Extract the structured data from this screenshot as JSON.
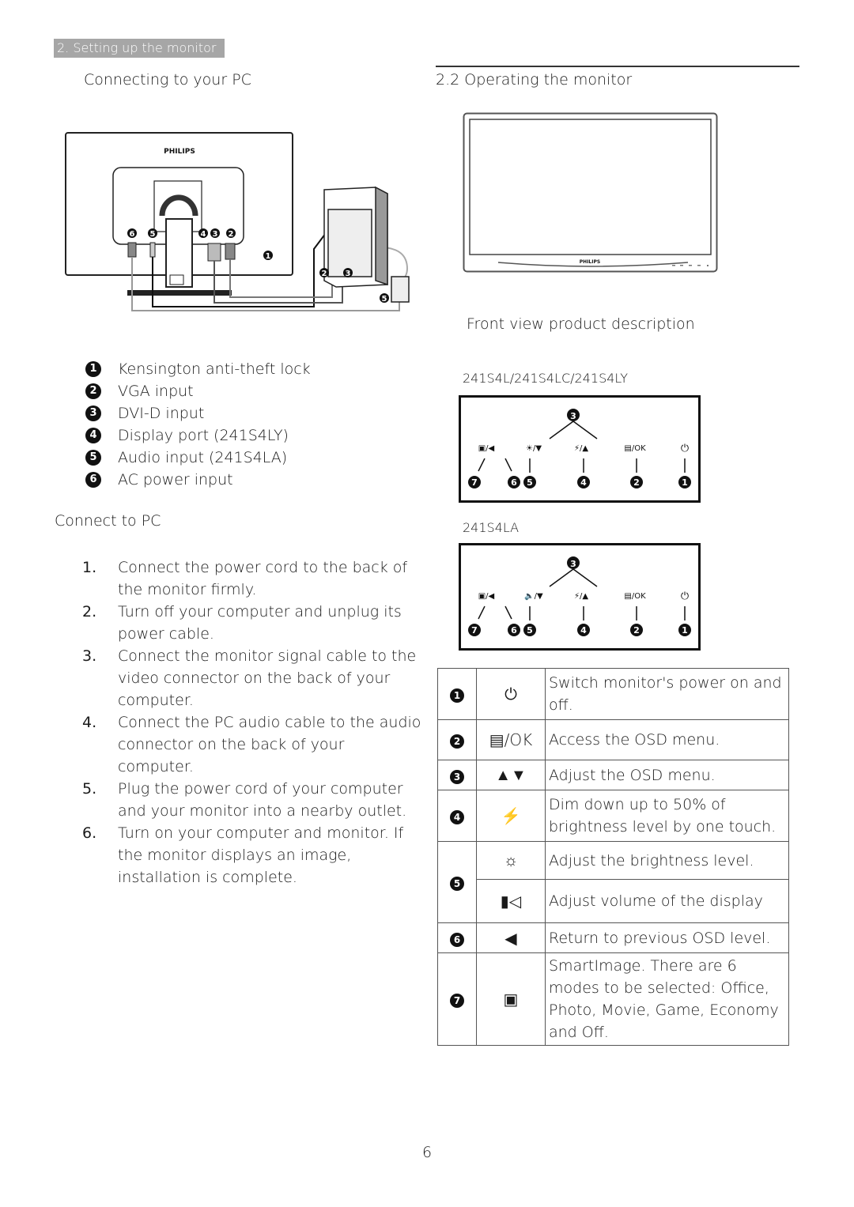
{
  "header": {
    "section_tab": "2. Setting up the monitor"
  },
  "left": {
    "title": "Connecting to your PC",
    "diagram": {
      "brand": "PHILIPS",
      "port_callouts": [
        "6",
        "5",
        "4",
        "3",
        "2",
        "1"
      ],
      "pc_callouts": [
        "2",
        "3",
        "5"
      ]
    },
    "legend": [
      {
        "num": "1",
        "label": "Kensington anti-theft lock"
      },
      {
        "num": "2",
        "label": "VGA input"
      },
      {
        "num": "3",
        "label": "DVI-D input"
      },
      {
        "num": "4",
        "label": "Display port (241S4LY)"
      },
      {
        "num": "5",
        "label": "Audio input (241S4LA)"
      },
      {
        "num": "6",
        "label": "AC power input"
      }
    ],
    "connect_title": "Connect to PC",
    "steps": [
      {
        "num": "1.",
        "text": "Connect the power cord to the back of the monitor firmly."
      },
      {
        "num": "2.",
        "text": "Turn off your computer and unplug its power cable."
      },
      {
        "num": "3.",
        "text": "Connect the monitor signal cable to the video connector on the back of your computer."
      },
      {
        "num": "4.",
        "text": "Connect the PC audio cable to the audio connector on the back of your computer."
      },
      {
        "num": "5.",
        "text": "Plug the power cord of your computer and your monitor into a nearby outlet."
      },
      {
        "num": "6.",
        "text": "Turn on your computer and monitor. If the monitor displays an image, installation is complete."
      }
    ]
  },
  "right": {
    "title": "2.2 Operating the monitor",
    "front_brand": "PHILIPS",
    "front_view_title": "Front view product description",
    "panels": [
      {
        "model": "241S4L/241S4LC/241S4LY",
        "buttons": [
          {
            "icon": "smartimage-back",
            "label": "▣/◀"
          },
          {
            "icon": "brightness-down",
            "label": "☀/▼"
          },
          {
            "icon": "smartcontrol-up",
            "label": "⚡/▲"
          },
          {
            "icon": "menu-ok",
            "label": "▤/OK"
          },
          {
            "icon": "power",
            "label": "⏻"
          }
        ],
        "callouts": [
          "7",
          "6",
          "5",
          "4",
          "2",
          "1"
        ],
        "top_callout": "3"
      },
      {
        "model": "241S4LA",
        "buttons": [
          {
            "icon": "smartimage-back",
            "label": "▣/◀"
          },
          {
            "icon": "volume-down",
            "label": "🔈/▼"
          },
          {
            "icon": "smartcontrol-up",
            "label": "⚡/▲"
          },
          {
            "icon": "menu-ok",
            "label": "▤/OK"
          },
          {
            "icon": "power",
            "label": "⏻"
          }
        ],
        "callouts": [
          "7",
          "6",
          "5",
          "4",
          "2",
          "1"
        ],
        "top_callout": "3"
      }
    ],
    "key_table": [
      {
        "num": "1",
        "icon": "power-icon",
        "symbol": "⏻",
        "desc": "Switch monitor's power on and off."
      },
      {
        "num": "2",
        "icon": "menu-ok-icon",
        "symbol": "▤/OK",
        "desc": "Access the OSD menu."
      },
      {
        "num": "3",
        "icon": "up-down-icon",
        "symbol": "▲▼",
        "desc": "Adjust the OSD menu."
      },
      {
        "num": "4",
        "icon": "smartpower-icon",
        "symbol": "⚡",
        "desc": "Dim down up to 50% of brightness level by one touch."
      },
      {
        "num": "5",
        "icon": "brightness-icon",
        "symbol": "☼",
        "desc": "Adjust the brightness level."
      },
      {
        "num": "",
        "icon": "volume-icon",
        "symbol": "▮◁",
        "desc": "Adjust volume of the display"
      },
      {
        "num": "6",
        "icon": "back-arrow-icon",
        "symbol": "◀",
        "desc": "Return to previous OSD level."
      },
      {
        "num": "7",
        "icon": "smartimage-icon",
        "symbol": "▣",
        "desc": "SmartImage. There are 6 modes to be selected: Office, Photo, Movie, Game, Economy and Off."
      }
    ]
  },
  "footer": {
    "page_number": "6"
  }
}
